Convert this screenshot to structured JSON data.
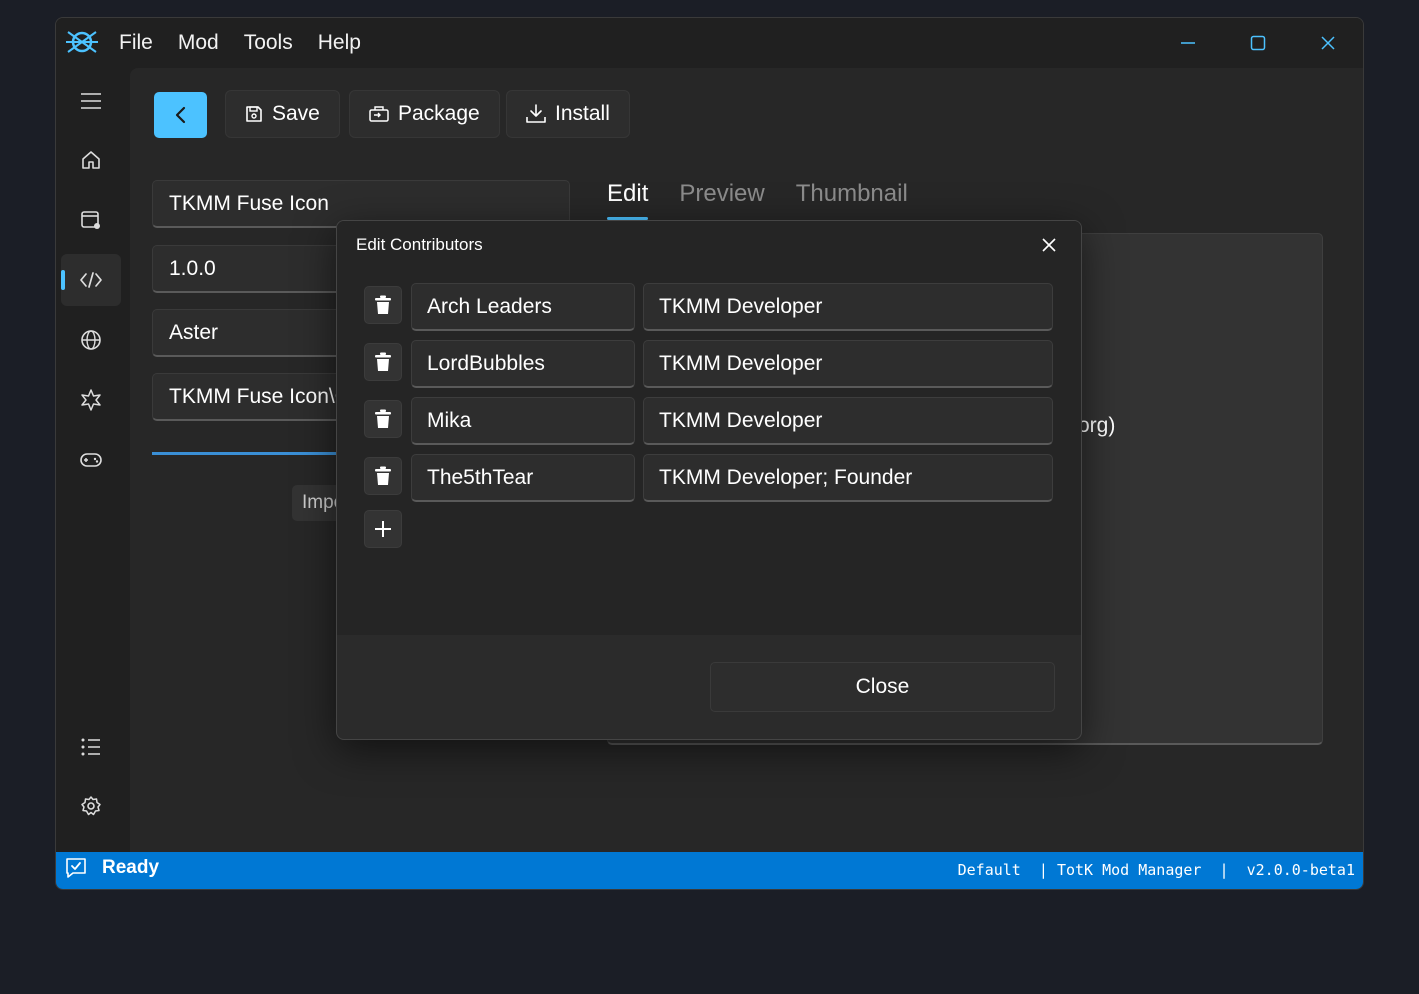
{
  "menu": [
    "File",
    "Mod",
    "Tools",
    "Help"
  ],
  "toolbar": {
    "save_label": "Save",
    "package_label": "Package",
    "install_label": "Install"
  },
  "form": {
    "name": "TKMM Fuse Icon",
    "version": "1.0.0",
    "author": "Aster",
    "path": "TKMM Fuse Icon\\C",
    "import_label": "Impo"
  },
  "tabs": [
    "Edit",
    "Preview",
    "Thumbnail"
  ],
  "editor_visible_text": "org)",
  "dialog": {
    "title": "Edit Contributors",
    "contributors": [
      {
        "name": "Arch Leaders",
        "role": "TKMM Developer"
      },
      {
        "name": "LordBubbles",
        "role": "TKMM Developer"
      },
      {
        "name": "Mika",
        "role": "TKMM Developer"
      },
      {
        "name": "The5thTear",
        "role": "TKMM Developer; Founder"
      }
    ],
    "close_label": "Close"
  },
  "status": {
    "state": "Ready",
    "profile": "Default ",
    "app": " | TotK Mod Manager ",
    "version": " |  v2.0.0-beta1"
  },
  "colors": {
    "accent": "#4cc2ff",
    "statusbar": "#0078d4"
  }
}
